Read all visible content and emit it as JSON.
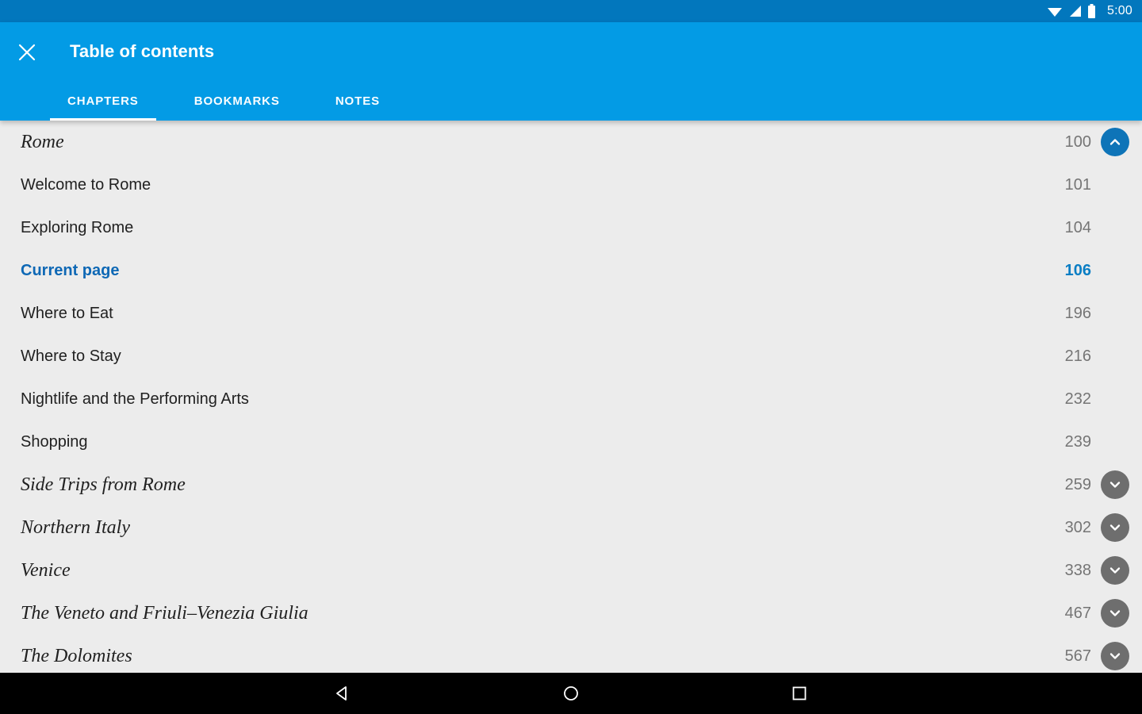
{
  "statusbar": {
    "time": "5:00",
    "icons": [
      "wifi-icon",
      "signal-icon",
      "battery-icon"
    ]
  },
  "appbar": {
    "close_icon": "close-icon",
    "title": "Table of contents",
    "tabs": [
      {
        "label": "CHAPTERS",
        "active": true
      },
      {
        "label": "BOOKMARKS",
        "active": false
      },
      {
        "label": "NOTES",
        "active": false
      }
    ]
  },
  "toc": {
    "rows": [
      {
        "label": "Rome",
        "page": "100",
        "kind": "chapter",
        "toggle": "collapse"
      },
      {
        "label": "Welcome to Rome",
        "page": "101",
        "kind": "section",
        "toggle": "none"
      },
      {
        "label": "Exploring Rome",
        "page": "104",
        "kind": "section",
        "toggle": "none"
      },
      {
        "label": "Current page",
        "page": "106",
        "kind": "current",
        "toggle": "none"
      },
      {
        "label": "Where to Eat",
        "page": "196",
        "kind": "section",
        "toggle": "none"
      },
      {
        "label": "Where to Stay",
        "page": "216",
        "kind": "section",
        "toggle": "none"
      },
      {
        "label": "Nightlife and the Performing Arts",
        "page": "232",
        "kind": "section",
        "toggle": "none"
      },
      {
        "label": "Shopping",
        "page": "239",
        "kind": "section",
        "toggle": "none"
      },
      {
        "label": "Side Trips from Rome",
        "page": "259",
        "kind": "chapter",
        "toggle": "expand"
      },
      {
        "label": "Northern Italy",
        "page": "302",
        "kind": "chapter",
        "toggle": "expand"
      },
      {
        "label": "Venice",
        "page": "338",
        "kind": "chapter",
        "toggle": "expand"
      },
      {
        "label": "The Veneto and Friuli–Venezia Giulia",
        "page": "467",
        "kind": "chapter",
        "toggle": "expand"
      },
      {
        "label": "The Dolomites",
        "page": "567",
        "kind": "chapter",
        "toggle": "expand"
      }
    ]
  },
  "navbar": {
    "buttons": [
      "back-icon",
      "home-icon",
      "recents-icon"
    ]
  },
  "colors": {
    "status_bar": "#0277bd",
    "app_bar": "#039be5",
    "background": "#ececec",
    "accent_blue": "#0e68b5",
    "page_number": "#757575",
    "collapse_button": "#0e74b8",
    "expand_button": "#6e6e6e"
  }
}
